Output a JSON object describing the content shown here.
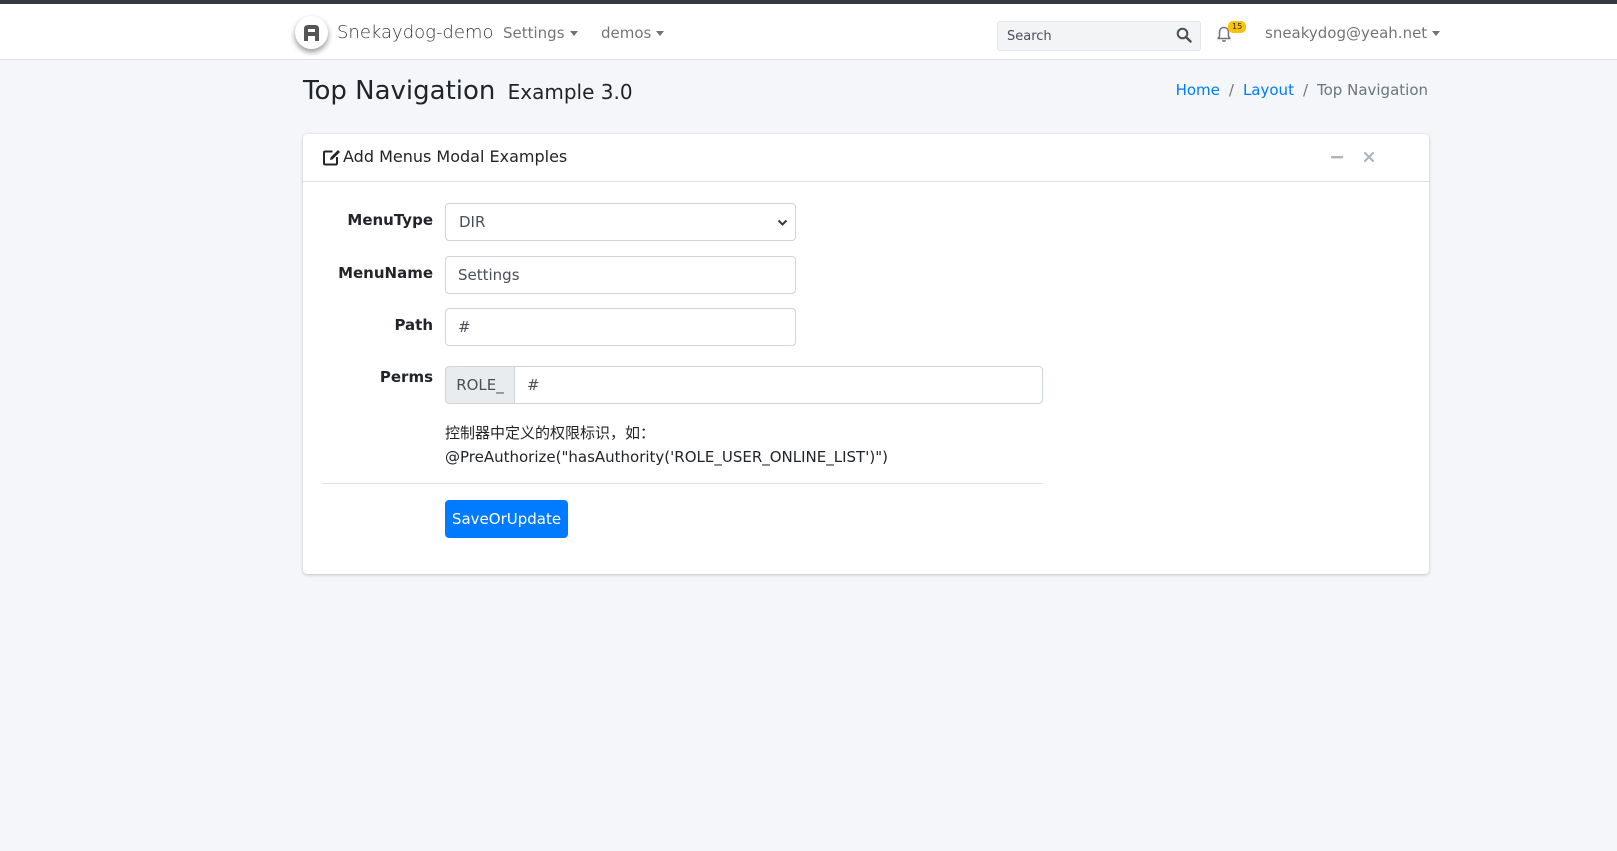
{
  "navbar": {
    "brand_name": "Snekaydog-demo",
    "menus": [
      {
        "label": "Settings"
      },
      {
        "label": "demos"
      }
    ],
    "search": {
      "placeholder": "Search",
      "value": ""
    },
    "notifications": {
      "count": "15"
    },
    "user": {
      "email": "sneakydog@yeah.net"
    }
  },
  "header": {
    "title": "Top Navigation",
    "subtitle": "Example 3.0",
    "breadcrumb": [
      {
        "label": "Home"
      },
      {
        "label": "Layout"
      },
      {
        "label": "Top Navigation"
      }
    ]
  },
  "card": {
    "title": "Add Menus Modal Examples",
    "form": {
      "menu_type": {
        "label": "MenuType",
        "value": "DIR"
      },
      "menu_name": {
        "label": "MenuName",
        "value": "Settings"
      },
      "path": {
        "label": "Path",
        "value": "#"
      },
      "perms": {
        "label": "Perms",
        "prefix": "ROLE_",
        "value": "#"
      },
      "help_line1": "控制器中定义的权限标识，如：",
      "help_line2": "@PreAuthorize(\"hasAuthority('ROLE_USER_ONLINE_LIST')\")",
      "submit_label": "SaveOrUpdate"
    }
  },
  "colors": {
    "primary": "#007bff",
    "badge": "#ffc107",
    "background": "#f4f6f9",
    "topbar": "#343a40"
  },
  "icons": [
    "brand-logo-icon",
    "search-icon",
    "bell-icon",
    "edit-icon",
    "minus-icon",
    "close-icon",
    "chevron-down-icon"
  ]
}
